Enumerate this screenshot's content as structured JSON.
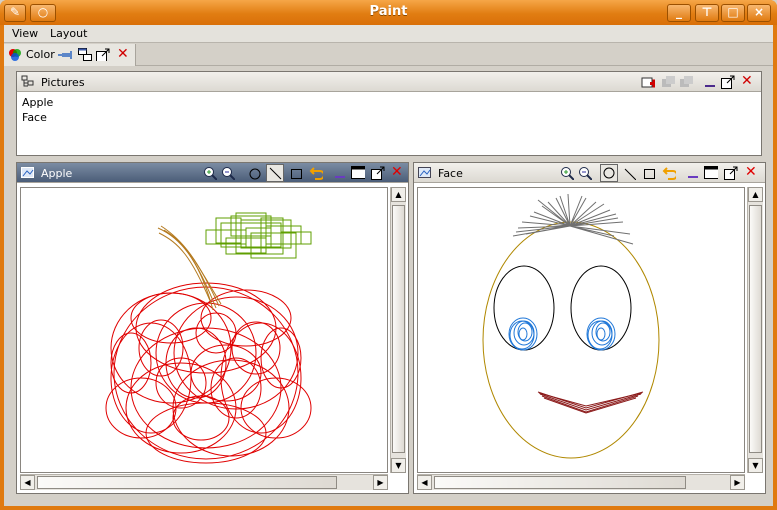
{
  "window": {
    "title": "Paint"
  },
  "menu": {
    "items": [
      "View",
      "Layout"
    ]
  },
  "color_tab": {
    "label": "Color",
    "accent": "#e07a10"
  },
  "pictures_panel": {
    "title": "Pictures",
    "items": [
      "Apple",
      "Face"
    ]
  },
  "apple_panel": {
    "title": "Apple",
    "icons": [
      "zoom-in-icon",
      "zoom-out-icon",
      "ellipse-tool-icon",
      "line-tool-icon",
      "rectangle-tool-icon",
      "undo-icon",
      "minimize-icon",
      "maximize-icon",
      "float-icon",
      "close-icon"
    ]
  },
  "face_panel": {
    "title": "Face",
    "icons": [
      "zoom-in-icon",
      "zoom-out-icon",
      "ellipse-tool-icon",
      "line-tool-icon",
      "rectangle-tool-icon",
      "undo-icon",
      "minimize-icon",
      "maximize-icon",
      "float-icon",
      "close-icon"
    ]
  },
  "colors": {
    "apple_red": "#e00000",
    "leaf_green": "#5f9f00",
    "stem_brown": "#b47a1f",
    "face_outline": "#b08800",
    "eye_blue": "#1f77d8",
    "mouth": "#8b1a1a",
    "hair": "#707070"
  }
}
